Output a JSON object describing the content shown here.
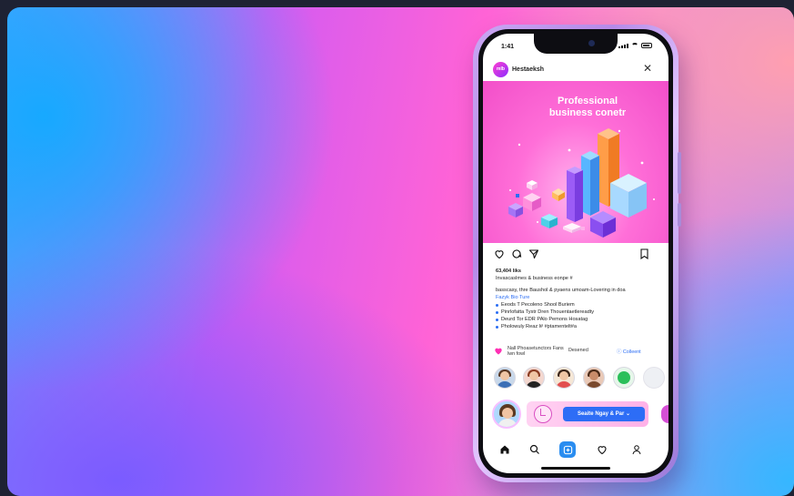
{
  "status_bar": {
    "time": "1:41"
  },
  "app": {
    "name": "Hestaeksh",
    "logo_text": "mlb"
  },
  "post": {
    "title_line1": "Professional",
    "title_line2": "business conetr",
    "likes": "63,404 liks",
    "author_caption": "Invascaslmes & business eonpe #",
    "caption_text": "basscasy, thre Baushol & pyaens umoam-Lovering in doa",
    "caption_link": "Fazyk Bio Ture",
    "bullets": [
      "Eeods T Pecoleno Shool Buriem",
      "Pinrlofatta Tystr Dren Thouentaetlereadty",
      "Deurd Tor EDR PAlo Pemons Hosatag",
      "Pholowuly Reaz l# #ptamentelt#a"
    ]
  },
  "liked_row": {
    "text": "Nall Phoasetunctors Fans lwn fowl",
    "hint": "Desenecl",
    "collect": "Colleent"
  },
  "promo": {
    "button_label": "Seaite Ngay & Par"
  },
  "colors": {
    "accent_pink": "#ff3fd1",
    "brand_blue": "#2d6df6"
  },
  "icons": {
    "actions": [
      "heart-icon",
      "comment-icon",
      "share-icon",
      "bookmark-icon"
    ],
    "nav": [
      "home-icon",
      "search-icon",
      "create-icon",
      "activity-heart-icon",
      "profile-icon"
    ]
  }
}
